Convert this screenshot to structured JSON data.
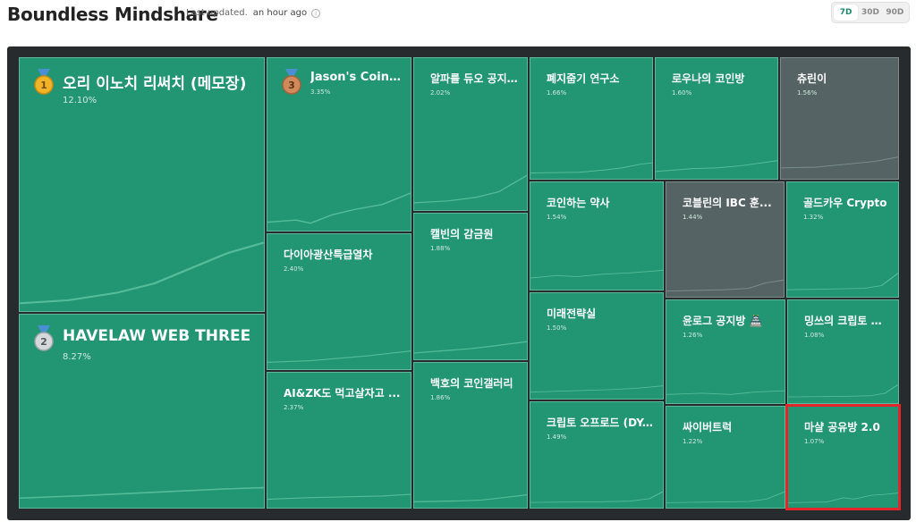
{
  "header": {
    "title": "Boundless Mindshare",
    "last_updated_label": "Last updated.",
    "last_updated_value": "an hour ago",
    "info_icon": "info-icon"
  },
  "range_tabs": [
    {
      "label": "7D",
      "active": true
    },
    {
      "label": "30D",
      "active": false
    },
    {
      "label": "90D",
      "active": false
    }
  ],
  "tiles": [
    {
      "rank": "1",
      "name": "오리 이노치 리써치 (메모장)",
      "share": "12.10%",
      "color": "#229573",
      "medal": "gold-medal-icon"
    },
    {
      "rank": "2",
      "name": "HAVELAW WEB THREE",
      "share": "8.27%",
      "color": "#229573",
      "medal": "silver-medal-icon"
    },
    {
      "rank": "3",
      "name": "Jason's Coin ...",
      "share": "3.35%",
      "color": "#229573",
      "medal": "bronze-medal-icon"
    },
    {
      "name": "다이아광산특급열차",
      "share": "2.40%",
      "color": "#229573"
    },
    {
      "name": "AI&ZK도 먹고살자고 ...",
      "share": "2.37%",
      "color": "#229573"
    },
    {
      "name": "알파를 듀오 공지...",
      "share": "2.02%",
      "color": "#229573"
    },
    {
      "name": "캘빈의 감금원",
      "share": "1.88%",
      "color": "#229573"
    },
    {
      "name": "백호의 코인갤러리",
      "share": "1.86%",
      "color": "#229573"
    },
    {
      "name": "폐지줍기 연구소",
      "share": "1.66%",
      "color": "#229573"
    },
    {
      "name": "로우나의 코인방",
      "share": "1.60%",
      "color": "#229573"
    },
    {
      "name": "츄린이",
      "share": "1.56%",
      "color": "#566364"
    },
    {
      "name": "코인하는 약사",
      "share": "1.54%",
      "color": "#229573"
    },
    {
      "name": "코블린의 IBC 훈...",
      "share": "1.44%",
      "color": "#566364"
    },
    {
      "name": "골드카우 Crypto",
      "share": "1.32%",
      "color": "#229573"
    },
    {
      "name": "미래전략실",
      "share": "1.50%",
      "color": "#229573"
    },
    {
      "name": "윤로그 공지방 🏯",
      "share": "1.26%",
      "color": "#229573"
    },
    {
      "name": "밍쓰의 크립토 이...",
      "share": "1.08%",
      "color": "#229573"
    },
    {
      "name": "크립토 오프로드 (DY...",
      "share": "1.49%",
      "color": "#229573"
    },
    {
      "name": "싸이버트럭",
      "share": "1.22%",
      "color": "#229573"
    },
    {
      "name": "마샬 공유방 2.0",
      "share": "1.07%",
      "color": "#229573",
      "highlighted": true
    }
  ]
}
